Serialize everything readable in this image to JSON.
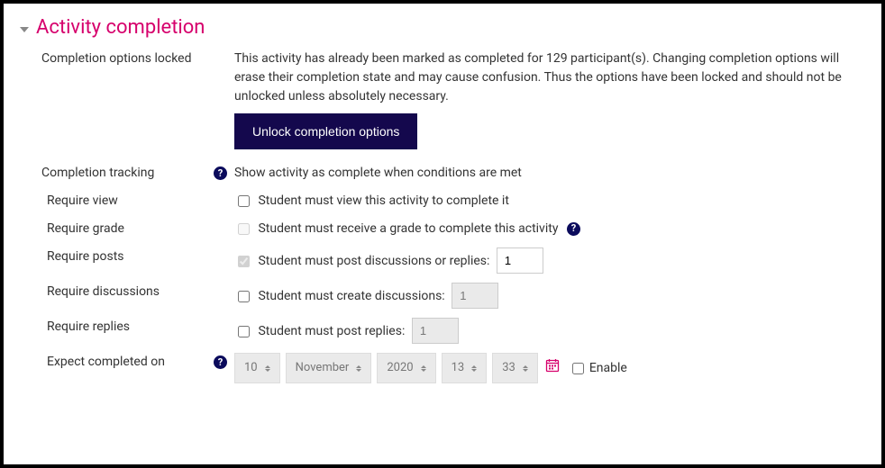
{
  "section": {
    "title": "Activity completion"
  },
  "locked": {
    "label": "Completion options locked",
    "message": "This activity has already been marked as completed for 129 participant(s). Changing completion options will erase their completion state and may cause confusion. Thus the options have been locked and should not be unlocked unless absolutely necessary.",
    "button": "Unlock completion options"
  },
  "tracking": {
    "label": "Completion tracking",
    "value": "Show activity as complete when conditions are met"
  },
  "require_view": {
    "label": "Require view",
    "checkbox_label": "Student must view this activity to complete it"
  },
  "require_grade": {
    "label": "Require grade",
    "checkbox_label": "Student must receive a grade to complete this activity"
  },
  "require_posts": {
    "label": "Require posts",
    "checkbox_label": "Student must post discussions or replies:",
    "value": "1"
  },
  "require_discussions": {
    "label": "Require discussions",
    "checkbox_label": "Student must create discussions:",
    "value": "1"
  },
  "require_replies": {
    "label": "Require replies",
    "checkbox_label": "Student must post replies:",
    "value": "1"
  },
  "expect": {
    "label": "Expect completed on",
    "day": "10",
    "month": "November",
    "year": "2020",
    "hour": "13",
    "minute": "33",
    "enable_label": "Enable"
  }
}
